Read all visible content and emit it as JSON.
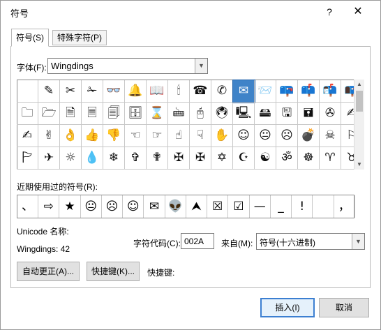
{
  "window": {
    "title": "符号",
    "help_label": "?",
    "close_label": "✕"
  },
  "tabs": [
    {
      "label": "符号(S)",
      "active": true
    },
    {
      "label": "特殊字符(P)",
      "active": false
    }
  ],
  "font": {
    "label": "字体(F):",
    "value": "Wingdings"
  },
  "symbol_grid": {
    "rows": [
      [
        " ",
        "✎",
        "✂",
        "✁",
        "👓",
        "🔔",
        "📖",
        "🕯",
        "☎",
        "✆",
        "✉",
        "📨",
        "📪",
        "📫",
        "📬",
        "📭"
      ],
      [
        "🗀",
        "🗁",
        "🗎",
        "🗏",
        "🗐",
        "🗄",
        "⌛",
        "🖮",
        "🖰",
        "🖲",
        "🖳",
        "🖴",
        "🖫",
        "🖬",
        "✇",
        "✍"
      ],
      [
        "✍",
        "✌",
        "👌",
        "👍",
        "👎",
        "☜",
        "☞",
        "☝",
        "☟",
        "✋",
        "☺",
        "😐",
        "☹",
        "💣",
        "☠",
        "⚐"
      ],
      [
        "🏱",
        "✈",
        "☼",
        "💧",
        "❄",
        "✞",
        "✟",
        "✠",
        "✠",
        "✡",
        "☪",
        "☯",
        "ॐ",
        "☸",
        "♈",
        "♉"
      ]
    ],
    "selected_symbol": "✉"
  },
  "recent": {
    "label": "近期使用过的符号(R):",
    "items": [
      "、",
      "⇨",
      "★",
      "😐",
      "☹",
      "☺",
      "✉",
      "👽",
      "⮝",
      "☒",
      "☑",
      "—",
      "_",
      "!",
      "",
      "，"
    ]
  },
  "unicode_name_label": "Unicode 名称:",
  "char_info": "Wingdings: 42",
  "char_code": {
    "label": "字符代码(C):",
    "value": "002A"
  },
  "from": {
    "label": "来自(M):",
    "value": "符号(十六进制)"
  },
  "buttons": {
    "autocorrect": "自动更正(A)...",
    "shortcut_key": "快捷键(K)...",
    "shortcut_label": "快捷键:",
    "insert": "插入(I)",
    "cancel": "取消"
  },
  "scroll_arrows": {
    "up": "▲",
    "down": "▼",
    "dropdown": "▼"
  },
  "colors": {
    "selection": "#3f83c8",
    "primary_border": "#3c7fd1"
  }
}
